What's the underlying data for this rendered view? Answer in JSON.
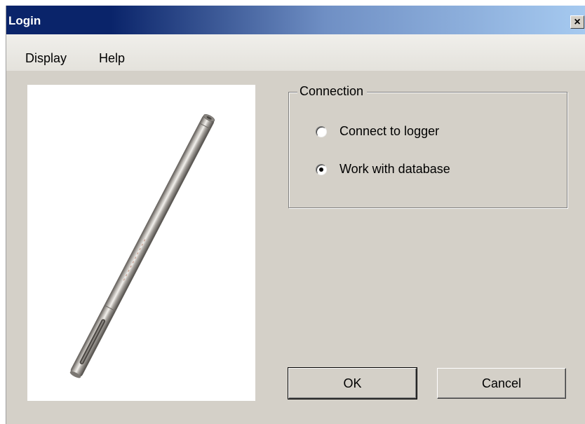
{
  "window": {
    "title": "Login",
    "close_glyph": "×"
  },
  "menu": {
    "items": [
      {
        "label": "Display"
      },
      {
        "label": "Help"
      }
    ]
  },
  "product_image": {
    "icon": "logger-probe-image"
  },
  "connection": {
    "legend": "Connection",
    "options": [
      {
        "label": "Connect to logger",
        "selected": false
      },
      {
        "label": "Work with database",
        "selected": true
      }
    ]
  },
  "buttons": {
    "ok": "OK",
    "cancel": "Cancel"
  },
  "colors": {
    "title_start": "#0a246a",
    "title_end": "#a6caf0",
    "window_bg": "#d4d0c8"
  }
}
